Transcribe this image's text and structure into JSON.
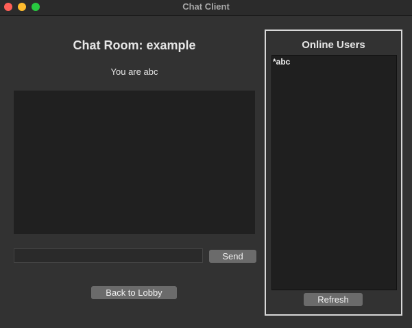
{
  "window": {
    "title": "Chat Client"
  },
  "chat": {
    "room_title": "Chat Room: example",
    "you_are": "You are abc",
    "message_input": {
      "value": "",
      "placeholder": ""
    },
    "send_label": "Send",
    "back_label": "Back to Lobby"
  },
  "users": {
    "title": "Online Users",
    "items": [
      "*abc"
    ],
    "refresh_label": "Refresh"
  },
  "colors": {
    "window_bg": "#323232",
    "panel_border": "#d8d8d8",
    "button_bg": "#6b6b6b",
    "list_bg": "#1f1f1f"
  }
}
